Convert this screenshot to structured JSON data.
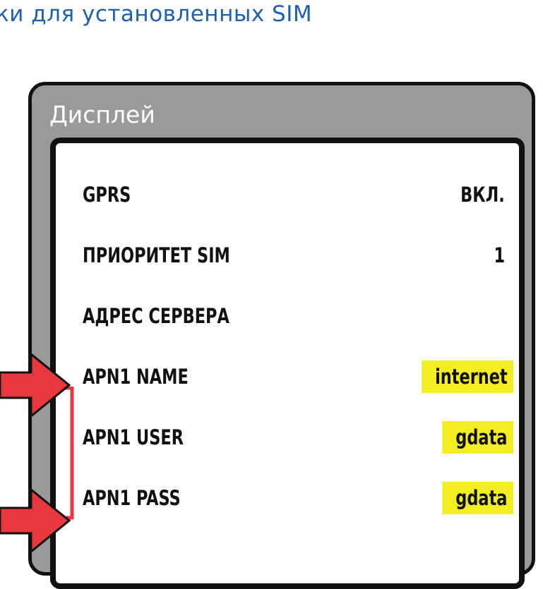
{
  "heading": "ки для установленных SIM",
  "device": {
    "title": "Дисплей"
  },
  "rows": [
    {
      "label": "GPRS",
      "value": "ВКЛ.",
      "highlight": false
    },
    {
      "label": "ПРИОРИТЕТ SIM",
      "value": "1",
      "highlight": false
    },
    {
      "label": "АДРЕС СЕРВЕРА",
      "value": "",
      "highlight": false
    },
    {
      "label": "APN1 NAME",
      "value": "internet",
      "highlight": true
    },
    {
      "label": "APN1 USER",
      "value": "gdata",
      "highlight": true
    },
    {
      "label": "APN1 PASS",
      "value": "gdata",
      "highlight": true
    }
  ],
  "colors": {
    "heading": "#1d5fb6",
    "highlight": "#f2ee22",
    "arrow": "#e8383d",
    "device_body": "#9a9a9a"
  }
}
